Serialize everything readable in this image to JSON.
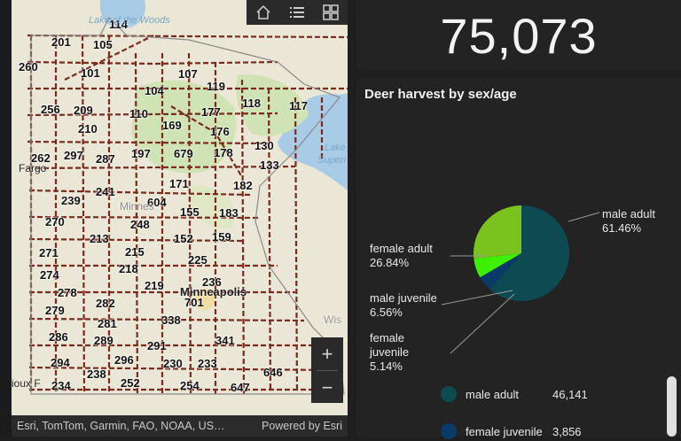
{
  "map": {
    "unit_labels": [
      {
        "id": "114",
        "t": "114"
      },
      {
        "id": "105",
        "t": "105"
      },
      {
        "id": "201",
        "t": "201"
      },
      {
        "id": "260",
        "t": "260"
      },
      {
        "id": "101",
        "t": "101"
      },
      {
        "id": "107",
        "t": "107"
      },
      {
        "id": "119",
        "t": "119"
      },
      {
        "id": "104",
        "t": "104"
      },
      {
        "id": "256",
        "t": "256"
      },
      {
        "id": "209",
        "t": "209"
      },
      {
        "id": "110",
        "t": "110"
      },
      {
        "id": "177",
        "t": "177"
      },
      {
        "id": "118",
        "t": "118"
      },
      {
        "id": "117",
        "t": "117"
      },
      {
        "id": "210",
        "t": "210"
      },
      {
        "id": "169",
        "t": "169"
      },
      {
        "id": "176",
        "t": "176"
      },
      {
        "id": "130",
        "t": "130"
      },
      {
        "id": "262",
        "t": "262"
      },
      {
        "id": "297",
        "t": "297"
      },
      {
        "id": "287",
        "t": "287"
      },
      {
        "id": "197",
        "t": "197"
      },
      {
        "id": "679",
        "t": "679"
      },
      {
        "id": "178",
        "t": "178"
      },
      {
        "id": "133",
        "t": "133"
      },
      {
        "id": "171",
        "t": "171"
      },
      {
        "id": "182",
        "t": "182"
      },
      {
        "id": "241",
        "t": "241"
      },
      {
        "id": "239",
        "t": "239"
      },
      {
        "id": "604",
        "t": "604"
      },
      {
        "id": "155",
        "t": "155"
      },
      {
        "id": "183",
        "t": "183"
      },
      {
        "id": "270",
        "t": "270"
      },
      {
        "id": "248",
        "t": "248"
      },
      {
        "id": "213",
        "t": "213"
      },
      {
        "id": "152",
        "t": "152"
      },
      {
        "id": "159",
        "t": "159"
      },
      {
        "id": "271",
        "t": "271"
      },
      {
        "id": "215",
        "t": "215"
      },
      {
        "id": "225",
        "t": "225"
      },
      {
        "id": "218",
        "t": "218"
      },
      {
        "id": "274",
        "t": "274"
      },
      {
        "id": "278",
        "t": "278"
      },
      {
        "id": "219",
        "t": "219"
      },
      {
        "id": "236",
        "t": "236"
      },
      {
        "id": "282",
        "t": "282"
      },
      {
        "id": "701",
        "t": "701"
      },
      {
        "id": "279",
        "t": "279"
      },
      {
        "id": "338",
        "t": "338"
      },
      {
        "id": "281",
        "t": "281"
      },
      {
        "id": "286",
        "t": "286"
      },
      {
        "id": "289",
        "t": "289"
      },
      {
        "id": "291",
        "t": "291"
      },
      {
        "id": "341",
        "t": "341"
      },
      {
        "id": "296",
        "t": "296"
      },
      {
        "id": "294",
        "t": "294"
      },
      {
        "id": "230",
        "t": "230"
      },
      {
        "id": "233",
        "t": "233"
      },
      {
        "id": "238",
        "t": "238"
      },
      {
        "id": "646",
        "t": "646"
      },
      {
        "id": "252",
        "t": "252"
      },
      {
        "id": "234",
        "t": "234"
      },
      {
        "id": "254",
        "t": "254"
      },
      {
        "id": "647",
        "t": "647"
      }
    ],
    "places": {
      "lake_woods": "Lake of the Woods",
      "fargo": "Fargo",
      "minneapolis": "Minneapolis",
      "sioux_falls": "ioux F",
      "lake_superior_1": "Lake",
      "lake_superior_2": "Superi",
      "wisconsin": "Wis",
      "minnesota": "Minnes"
    },
    "toolbar": {
      "home_icon": "home-icon",
      "list_icon": "layer-list-icon",
      "grid_icon": "basemap-gallery-icon"
    },
    "zoom": {
      "in_label": "+",
      "out_label": "−"
    },
    "attribution": "Esri, TomTom, Garmin, FAO, NOAA, US…",
    "powered_by": "Powered by Esri",
    "colors": {
      "boundary": "#7a2b1e",
      "forest": "#cfe3b4",
      "land": "#ece8d6",
      "water": "#a9cce6"
    }
  },
  "total": {
    "value": "75,073"
  },
  "chart": {
    "title": "Deer harvest by sex/age",
    "legend": [
      {
        "name": "male adult",
        "value": "46,141",
        "color": "#0d4a52"
      },
      {
        "name": "female juvenile",
        "value": "3,856",
        "color": "#0a3a6a"
      }
    ]
  },
  "chart_data": {
    "type": "pie",
    "title": "Deer harvest by sex/age",
    "slices": [
      {
        "label": "male adult",
        "percent": 61.46,
        "pct_text": "61.46%",
        "color": "#0d4a52"
      },
      {
        "label": "female juvenile",
        "percent": 5.14,
        "pct_text": "5.14%",
        "color": "#0a3a6a"
      },
      {
        "label": "male juvenile",
        "percent": 6.56,
        "pct_text": "6.56%",
        "color": "#3cf000"
      },
      {
        "label": "female adult",
        "percent": 26.84,
        "pct_text": "26.84%",
        "color": "#7ac21e"
      }
    ],
    "values_shown": [
      {
        "label": "male adult",
        "value": 46141
      },
      {
        "label": "female juvenile",
        "value": 3856
      }
    ]
  }
}
